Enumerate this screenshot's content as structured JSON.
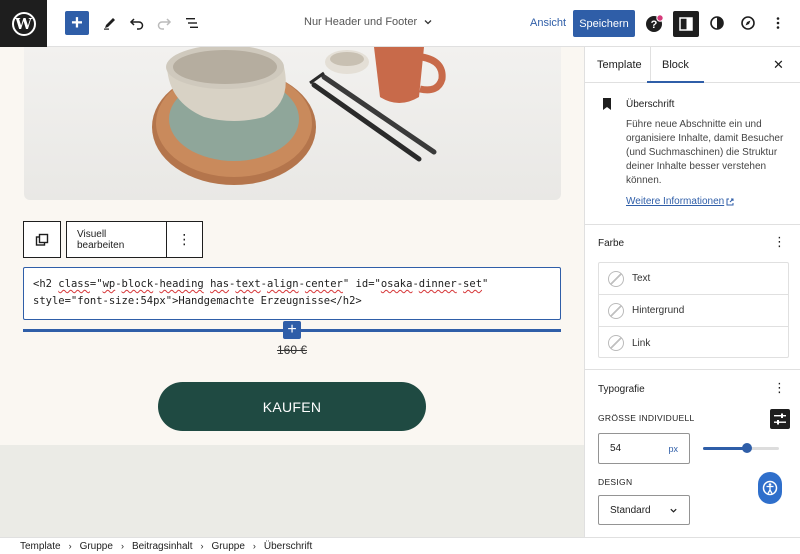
{
  "topbar": {
    "doc_title": "Nur Header und Footer",
    "view_label": "Ansicht",
    "save_label": "Speichern"
  },
  "canvas": {
    "toolbar": {
      "visual_edit": "Visuell bearbeiten",
      "more": "⋮"
    },
    "html_code": {
      "p1": "<h2 ",
      "class_attr": "class",
      "p2": "=\"",
      "wp": "wp",
      "p3": "-",
      "block": "block",
      "p4": "-",
      "heading": "heading",
      "p5": " ",
      "has": "has",
      "p6": "-",
      "text": "text",
      "p7": "-",
      "align": "align",
      "p8": "-",
      "center": "center",
      "p9": "\" ",
      "id_attr": "id",
      "p10": "=\"",
      "osaka": "osaka",
      "p11": "-",
      "dinner": "dinner",
      "p12": "-",
      "set": "set",
      "p13": "\"",
      "line2": "style=\"font-size:54px\">Handgemachte Erzeugnisse</h2>"
    },
    "price": "160 €",
    "buy_label": "KAUFEN"
  },
  "sidebar": {
    "tabs": [
      "Template",
      "Block"
    ],
    "block": {
      "title": "Überschrift",
      "description": "Führe neue Abschnitte ein und organisiere Inhalte, damit Besucher (und Suchmaschinen) die Struktur deiner Inhalte besser verstehen können.",
      "more_info": "Weitere Informationen"
    },
    "color": {
      "title": "Farbe",
      "items": [
        "Text",
        "Hintergrund",
        "Link"
      ]
    },
    "typography": {
      "title": "Typografie",
      "custom_size_label": "GRÖSSE INDIVIDUELL",
      "size_value": "54",
      "size_unit": "px",
      "slider_fraction": 0.58,
      "design_label": "DESIGN",
      "design_value": "Standard"
    }
  },
  "breadcrumb": [
    "Template",
    "Gruppe",
    "Beitragsinhalt",
    "Gruppe",
    "Überschrift"
  ],
  "colors": {
    "accent": "#2f5ea8",
    "buy_button": "#1f4a42",
    "dark": "#1e1e1e"
  }
}
